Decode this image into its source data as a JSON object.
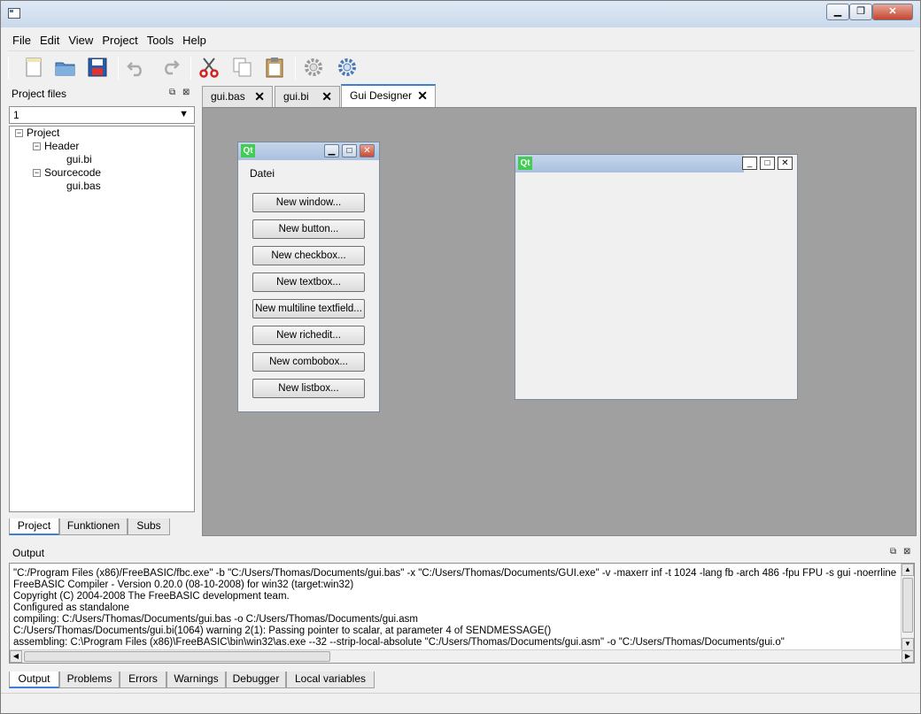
{
  "window": {
    "minimize": "▁",
    "maximize": "❐",
    "close": "✕"
  },
  "menu": [
    "File",
    "Edit",
    "View",
    "Project",
    "Tools",
    "Help"
  ],
  "toolbar": [
    "new-file-icon",
    "open-folder-icon",
    "save-icon",
    "undo-icon",
    "redo-icon",
    "cut-icon",
    "copy-icon",
    "paste-icon",
    "settings-icon",
    "build-settings-icon"
  ],
  "project_panel": {
    "title": "Project files",
    "combo_value": "1",
    "tree": [
      {
        "label": "Project",
        "expander": "−"
      },
      {
        "label": "Header",
        "expander": "−"
      },
      {
        "label": "gui.bi"
      },
      {
        "label": "Sourcecode",
        "expander": "−"
      },
      {
        "label": "gui.bas"
      }
    ],
    "tabs": [
      "Project",
      "Funktionen",
      "Subs"
    ]
  },
  "editor": {
    "tabs": [
      "gui.bas",
      "gui.bi",
      "Gui Designer"
    ],
    "active_tab": "Gui Designer"
  },
  "designer": {
    "toolbox": {
      "logo": "Qt",
      "menu": "Datei",
      "buttons": [
        "New window...",
        "New button...",
        "New checkbox...",
        "New textbox...",
        "New multiline textfield...",
        "New richedit...",
        "New combobox...",
        "New listbox..."
      ]
    },
    "form": {
      "logo": "Qt"
    }
  },
  "output": {
    "title": "Output",
    "lines": [
      "\"C:/Program Files (x86)/FreeBASIC/fbc.exe\" -b \"C:/Users/Thomas/Documents/gui.bas\" -x \"C:/Users/Thomas/Documents/GUI.exe\" -v -maxerr inf -t 1024 -lang fb -arch 486 -fpu FPU -s gui -noerrline",
      "FreeBASIC Compiler - Version 0.20.0 (08-10-2008) for win32 (target:win32)",
      "Copyright (C) 2004-2008 The FreeBASIC development team.",
      "Configured as standalone",
      "compiling:    C:/Users/Thomas/Documents/gui.bas -o C:/Users/Thomas/Documents/gui.asm",
      "C:/Users/Thomas/Documents/gui.bi(1064) warning 2(1): Passing pointer to scalar, at parameter 4 of SENDMESSAGE()",
      "assembling:   C:\\Program Files (x86)\\FreeBASIC\\bin\\win32\\as.exe --32 --strip-local-absolute \"C:/Users/Thomas/Documents/gui.asm\" -o \"C:/Users/Thomas/Documents/gui.o\""
    ],
    "tabs": [
      "Output",
      "Problems",
      "Errors",
      "Warnings",
      "Debugger",
      "Local variables"
    ]
  }
}
